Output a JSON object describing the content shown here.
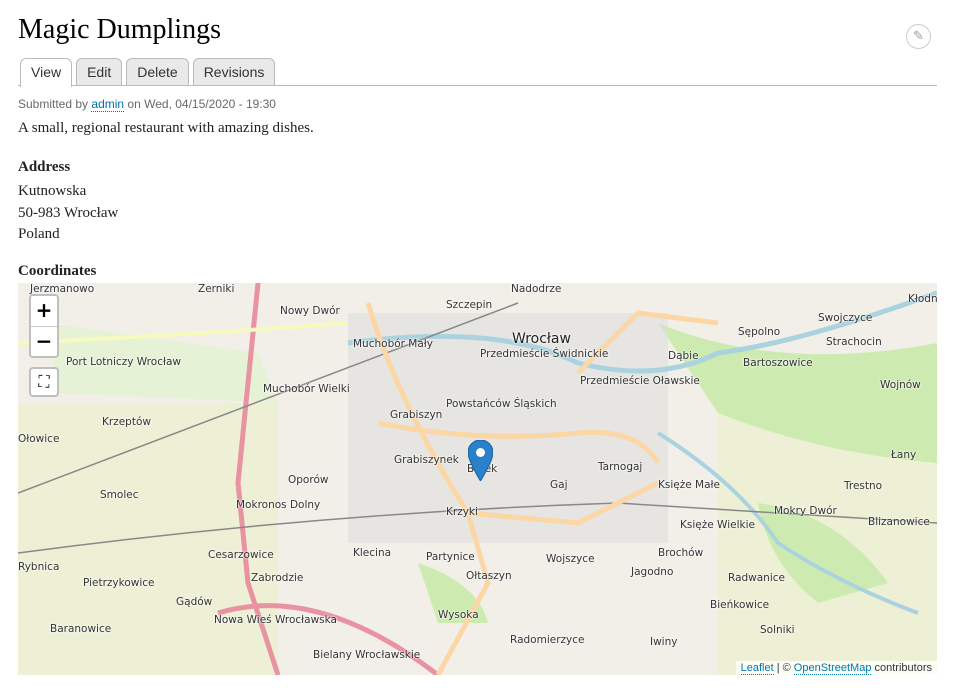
{
  "page": {
    "title": "Magic Dumplings",
    "edit_icon": "pencil-icon"
  },
  "tabs": [
    {
      "label": "View",
      "active": true
    },
    {
      "label": "Edit"
    },
    {
      "label": "Delete"
    },
    {
      "label": "Revisions"
    }
  ],
  "meta": {
    "prefix": "Submitted by",
    "author": "admin",
    "suffix": "on Wed, 04/15/2020 - 19:30"
  },
  "body": "A small, regional restaurant with amazing dishes.",
  "address": {
    "label": "Address",
    "line1": "Kutnowska",
    "line2": "50-983 Wrocław",
    "line3": "Poland"
  },
  "coordinates": {
    "label": "Coordinates"
  },
  "map": {
    "zoom_in": "+",
    "zoom_out": "−",
    "fullscreen_icon": "fullscreen-icon",
    "attribution": {
      "leaflet": "Leaflet",
      "sep": "| ©",
      "osm": "OpenStreetMap",
      "contributors": "contributors"
    },
    "colors": {
      "land": "#f2efe9",
      "green": "#cdebb0",
      "water": "#aad3df",
      "motorway": "#e892a2",
      "primary": "#fcd6a4",
      "marker": "#2a81cb"
    },
    "places": [
      "Jerzmanowo",
      "Żerniki",
      "Nowy Dwór",
      "Szczepin",
      "Nadodrze",
      "Wrocław",
      "Sępolno",
      "Swojczyce",
      "Strachocin",
      "Muchobór Mały",
      "Przedmieście Świdnickie",
      "Przedmieście Oławskie",
      "Dąbie",
      "Bartoszowice",
      "Port Lotniczy Wrocław",
      "Muchobór Wielki",
      "Powstańców Śląskich",
      "Wojnów",
      "Krzeptów",
      "Grabiszyn",
      "Grabiszynek",
      "Borek",
      "Tarnogaj",
      "Łany",
      "Oporów",
      "Gaj",
      "Księże Małe",
      "Trestno",
      "Smolec",
      "Mokronos Dolny",
      "Krzyki",
      "Mokry Dwór",
      "Blizanowice",
      "Księże Wielkie",
      "Cesarzowice",
      "Klecina",
      "Partynice",
      "Wojszyce",
      "Brochów",
      "Rybnica",
      "Zabrodzie",
      "Ołtaszyn",
      "Jagodno",
      "Radwanice",
      "Pietrzykowice",
      "Gądów",
      "Nowa Wieś Wrocławska",
      "Wysoka",
      "Bieńkowice",
      "Baranowice",
      "Radomierzyce",
      "Iwiny",
      "Solniki",
      "Bielany Wrocławskie",
      "Kłodnica",
      "Ołowice"
    ]
  }
}
